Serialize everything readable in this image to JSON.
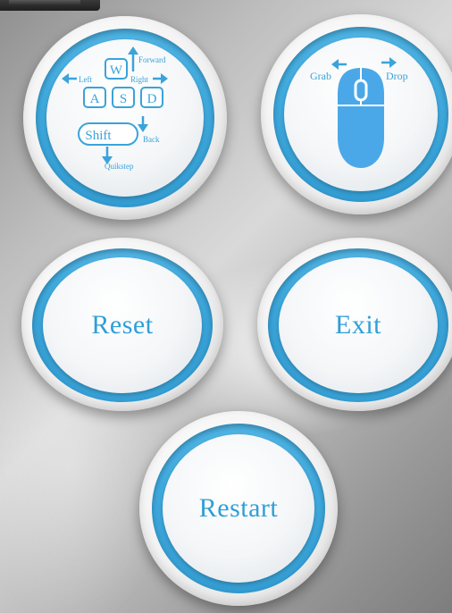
{
  "keyboard_help": {
    "keys": [
      "W",
      "A",
      "S",
      "D"
    ],
    "shift_key": "Shift",
    "left_label": "Left",
    "forward_label": "Forward",
    "right_label": "Right",
    "back_label": "Back",
    "quickstep_label": "Quikstep"
  },
  "mouse_help": {
    "grab_label": "Grab",
    "drop_label": "Drop"
  },
  "buttons": {
    "reset": "Reset",
    "exit": "Exit",
    "restart": "Restart"
  },
  "colors": {
    "accent": "#3aa3da",
    "ring": "#3ea8dc",
    "mouse_fill": "#4aa8e8"
  }
}
